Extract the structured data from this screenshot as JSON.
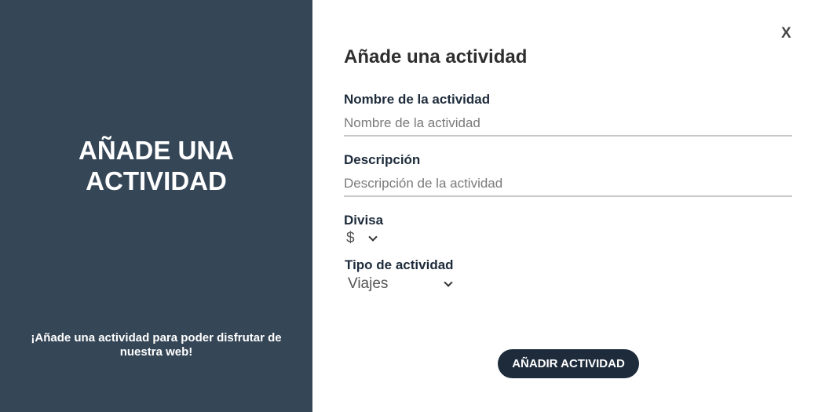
{
  "left_panel": {
    "hero_line1": "AÑADE UNA",
    "hero_line2": "ACTIVIDAD",
    "tagline": "¡Añade una actividad para poder disfrutar de nuestra web!"
  },
  "form": {
    "close_label": "X",
    "title": "Añade una actividad",
    "name_label": "Nombre de la actividad",
    "name_placeholder": "Nombre de la actividad",
    "name_value": "",
    "description_label": "Descripción",
    "description_placeholder": "Descripción de la actividad",
    "description_value": "",
    "currency_label": "Divisa",
    "currency_selected": "$",
    "type_label": "Tipo de actividad",
    "type_selected": "Viajes",
    "submit_label": "AÑADIR ACTIVIDAD"
  },
  "colors": {
    "left_panel_bg": "#354657",
    "button_bg": "#1d2b3b",
    "label_color": "#1d2b3b"
  },
  "icons": {
    "close": "close-icon",
    "dropdown": "chevron-down-icon"
  }
}
